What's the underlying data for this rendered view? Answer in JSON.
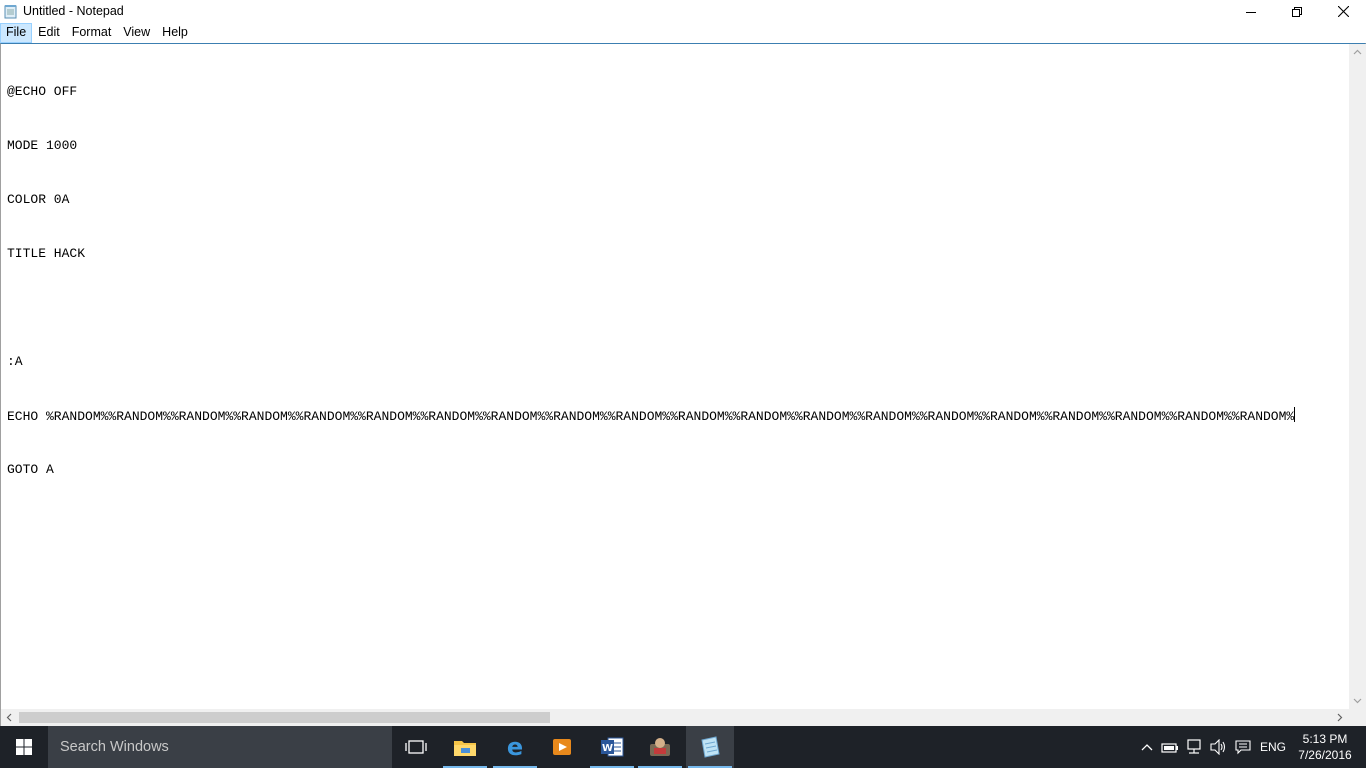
{
  "window": {
    "title": "Untitled - Notepad"
  },
  "menu": {
    "items": [
      {
        "label": "File",
        "active": true
      },
      {
        "label": "Edit",
        "active": false
      },
      {
        "label": "Format",
        "active": false
      },
      {
        "label": "View",
        "active": false
      },
      {
        "label": "Help",
        "active": false
      }
    ]
  },
  "editor": {
    "lines": [
      "@ECHO OFF",
      "MODE 1000",
      "COLOR 0A",
      "TITLE HACK",
      "",
      ":A",
      "ECHO %RANDOM%%RANDOM%%RANDOM%%RANDOM%%RANDOM%%RANDOM%%RANDOM%%RANDOM%%RANDOM%%RANDOM%%RANDOM%%RANDOM%%RANDOM%%RANDOM%%RANDOM%%RANDOM%%RANDOM%%RANDOM%%RANDOM%%RANDOM%",
      "GOTO A"
    ],
    "caret_line": 6
  },
  "taskbar": {
    "search_placeholder": "Search Windows",
    "pinned": [
      {
        "name": "task-view-icon"
      },
      {
        "name": "file-explorer-icon"
      },
      {
        "name": "edge-icon"
      },
      {
        "name": "media-player-icon"
      },
      {
        "name": "word-icon"
      },
      {
        "name": "game-app-icon"
      },
      {
        "name": "notepad-icon"
      }
    ],
    "language": "ENG",
    "time": "5:13 PM",
    "date": "7/26/2016"
  },
  "colors": {
    "taskbar": "#1e2228",
    "search_box": "#3a3f46",
    "accent": "#76b9ed",
    "menu_highlight": "#cce8ff"
  }
}
